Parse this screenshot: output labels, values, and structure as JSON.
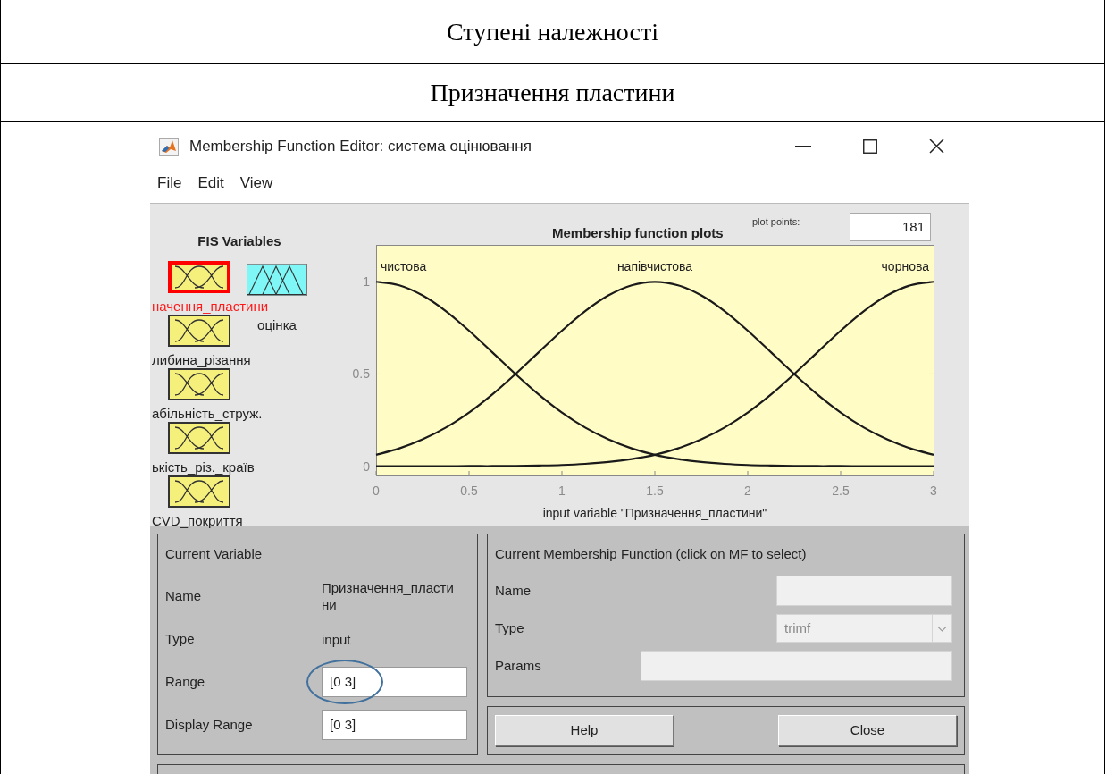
{
  "document_table": {
    "rows": [
      "Ступені належності",
      "Призначення пластини"
    ]
  },
  "window": {
    "title": "Membership Function Editor: система оцінювання",
    "menu": [
      "File",
      "Edit",
      "View"
    ]
  },
  "fis_variables": {
    "title": "FIS Variables",
    "items": [
      {
        "label": "начення_пластини",
        "kind": "input",
        "selected": true
      },
      {
        "label": "либина_різання",
        "kind": "input",
        "selected": false
      },
      {
        "label": "абільність_струж.",
        "kind": "input",
        "selected": false
      },
      {
        "label": "ькість_різ._країв",
        "kind": "input",
        "selected": false
      },
      {
        "label": "CVD_покриття",
        "kind": "input",
        "selected": false
      },
      {
        "label": "оцінка",
        "kind": "output",
        "selected": false
      }
    ]
  },
  "plot": {
    "plot_points_label": "plot points:",
    "plot_points": "181",
    "chart_data": {
      "type": "line",
      "title": "Membership function plots",
      "xlabel": "input variable \"Призначення_пластини\"",
      "x": [
        0,
        0.125,
        0.25,
        0.375,
        0.5,
        0.625,
        0.75,
        0.875,
        1,
        1.125,
        1.25,
        1.375,
        1.5,
        1.625,
        1.75,
        1.875,
        2,
        2.125,
        2.25,
        2.375,
        2.5,
        2.625,
        2.75,
        2.875,
        3
      ],
      "xlim": [
        0,
        3
      ],
      "ylim": [
        -0.05,
        1.2
      ],
      "xticks": [
        0,
        0.5,
        1,
        1.5,
        2,
        2.5,
        3
      ],
      "yticks": [
        0,
        0.5,
        1
      ],
      "series": [
        {
          "name": "чистова",
          "values": [
            1,
            0.981,
            0.926,
            0.841,
            0.735,
            0.618,
            0.5,
            0.389,
            0.291,
            0.21,
            0.146,
            0.097,
            0.062,
            0.039,
            0.023,
            0.013,
            0.007,
            0.004,
            0.002,
            0.001,
            0.001,
            0,
            0,
            0,
            0
          ]
        },
        {
          "name": "напівчистова",
          "values": [
            0.062,
            0.097,
            0.146,
            0.21,
            0.291,
            0.389,
            0.5,
            0.618,
            0.735,
            0.841,
            0.926,
            0.981,
            1,
            0.981,
            0.926,
            0.841,
            0.735,
            0.618,
            0.5,
            0.389,
            0.291,
            0.21,
            0.146,
            0.097,
            0.062
          ]
        },
        {
          "name": "чорнова",
          "values": [
            0,
            0,
            0,
            0,
            0.001,
            0.001,
            0.002,
            0.004,
            0.007,
            0.013,
            0.023,
            0.039,
            0.062,
            0.097,
            0.146,
            0.21,
            0.291,
            0.389,
            0.5,
            0.618,
            0.735,
            0.841,
            0.926,
            0.981,
            1
          ]
        }
      ]
    }
  },
  "current_variable": {
    "title": "Current Variable",
    "fields": [
      {
        "label": "Name",
        "kind": "text",
        "value": "Призначення_пластини"
      },
      {
        "label": "Type",
        "kind": "text",
        "value": "input"
      },
      {
        "label": "Range",
        "kind": "input",
        "value": "[0 3]",
        "highlighted": true
      },
      {
        "label": "Display Range",
        "kind": "input",
        "value": "[0 3]",
        "highlighted": false
      }
    ]
  },
  "current_mf": {
    "title": "Current Membership Function (click on MF to select)",
    "fields": [
      {
        "label": "Name",
        "kind": "input",
        "disabled": true
      },
      {
        "label": "Type",
        "kind": "dropdown",
        "value": "trimf",
        "disabled": true
      },
      {
        "label": "Params",
        "kind": "input",
        "disabled": true
      }
    ]
  },
  "buttons": [
    "Help",
    "Close"
  ]
}
